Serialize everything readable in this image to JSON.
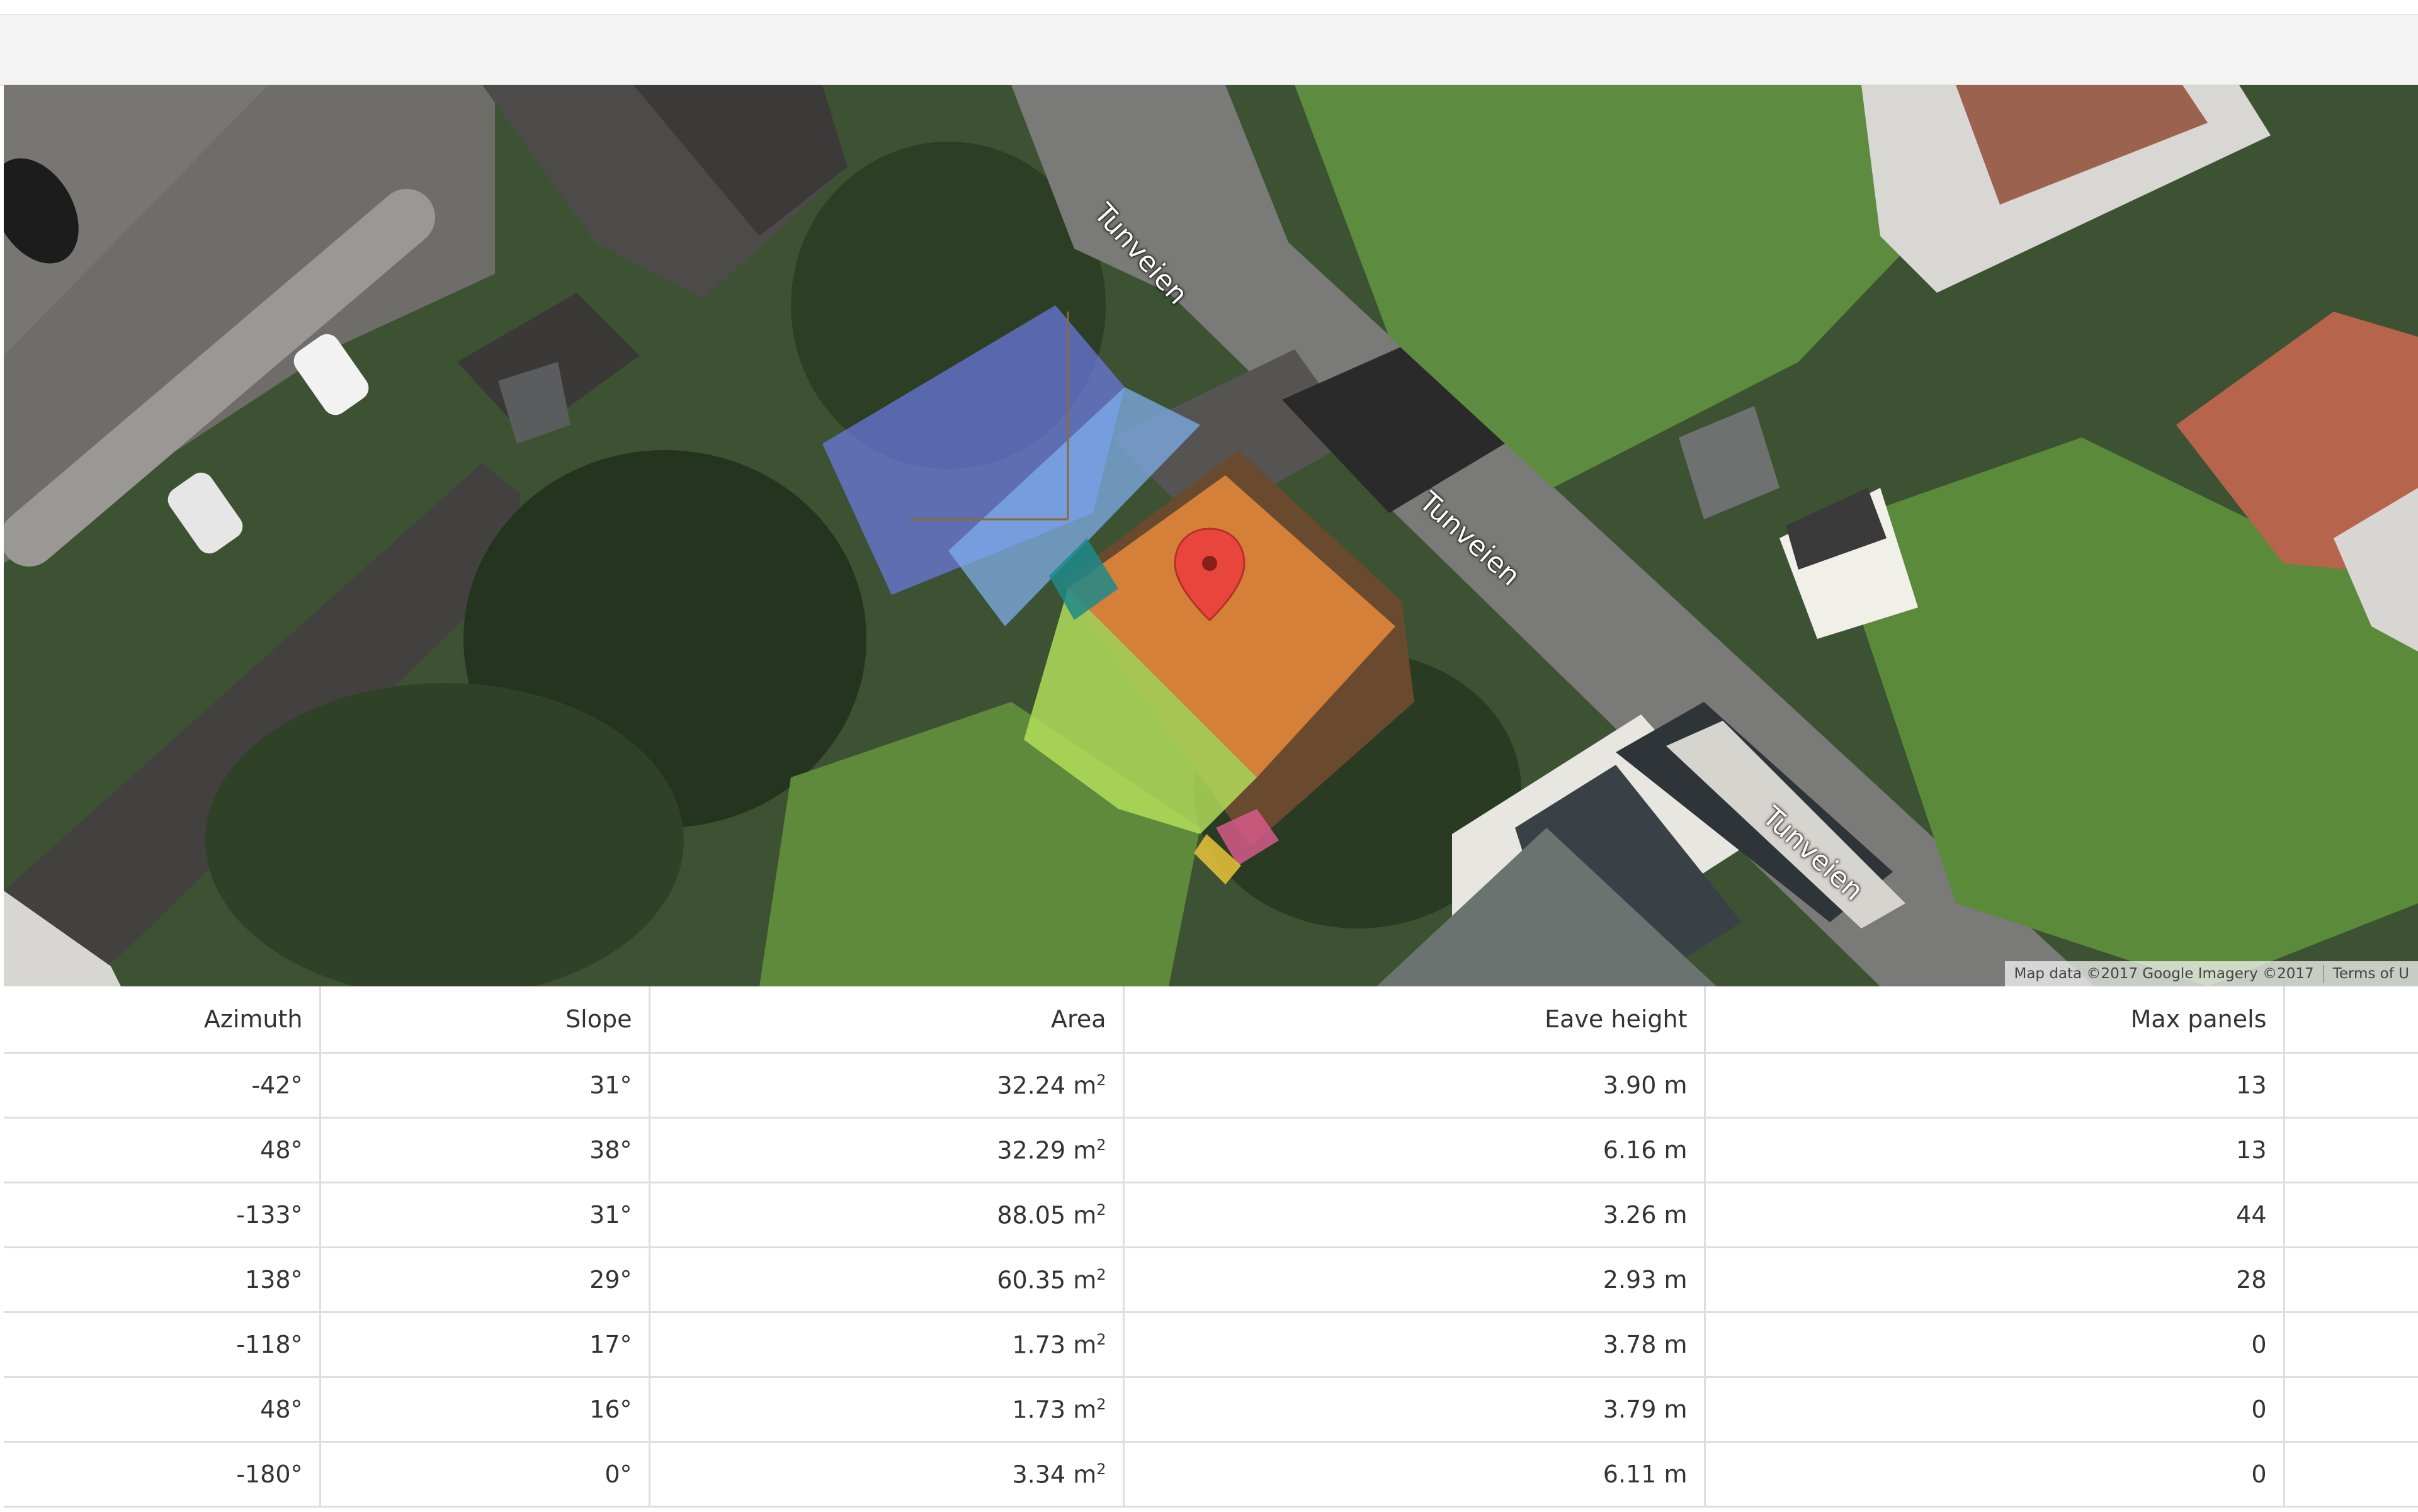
{
  "map": {
    "road_labels": [
      "Tunveien",
      "Tunveien",
      "Tunveien"
    ],
    "attribution": "Map data ©2017 Google Imagery ©2017",
    "terms": "Terms of U",
    "marker_icon": "map-pin-icon"
  },
  "table": {
    "headers": {
      "azimuth": "Azimuth",
      "slope": "Slope",
      "area": "Area",
      "eave_height": "Eave height",
      "max_panels": "Max panels"
    },
    "rows": [
      {
        "azimuth": "-42°",
        "slope": "31°",
        "area": "32.24 m",
        "eave_height": "3.90 m",
        "max_panels": "13"
      },
      {
        "azimuth": "48°",
        "slope": "38°",
        "area": "32.29 m",
        "eave_height": "6.16 m",
        "max_panels": "13"
      },
      {
        "azimuth": "-133°",
        "slope": "31°",
        "area": "88.05 m",
        "eave_height": "3.26 m",
        "max_panels": "44"
      },
      {
        "azimuth": "138°",
        "slope": "29°",
        "area": "60.35 m",
        "eave_height": "2.93 m",
        "max_panels": "28"
      },
      {
        "azimuth": "-118°",
        "slope": "17°",
        "area": "1.73 m",
        "eave_height": "3.78 m",
        "max_panels": "0"
      },
      {
        "azimuth": "48°",
        "slope": "16°",
        "area": "1.73 m",
        "eave_height": "3.79 m",
        "max_panels": "0"
      },
      {
        "azimuth": "-180°",
        "slope": "0°",
        "area": "3.34 m",
        "eave_height": "6.11 m",
        "max_panels": "0"
      }
    ],
    "area_unit_sup": "2"
  },
  "colors": {
    "roof_blue": "#6b78e0",
    "roof_light_blue": "#7fb0ee",
    "roof_orange": "#e8893a",
    "roof_green": "#b5e05a",
    "roof_teal": "#1f8a8a",
    "roof_pink": "#d65a8a",
    "roof_yellow": "#e8c43a",
    "marker_red": "#e8453c"
  }
}
